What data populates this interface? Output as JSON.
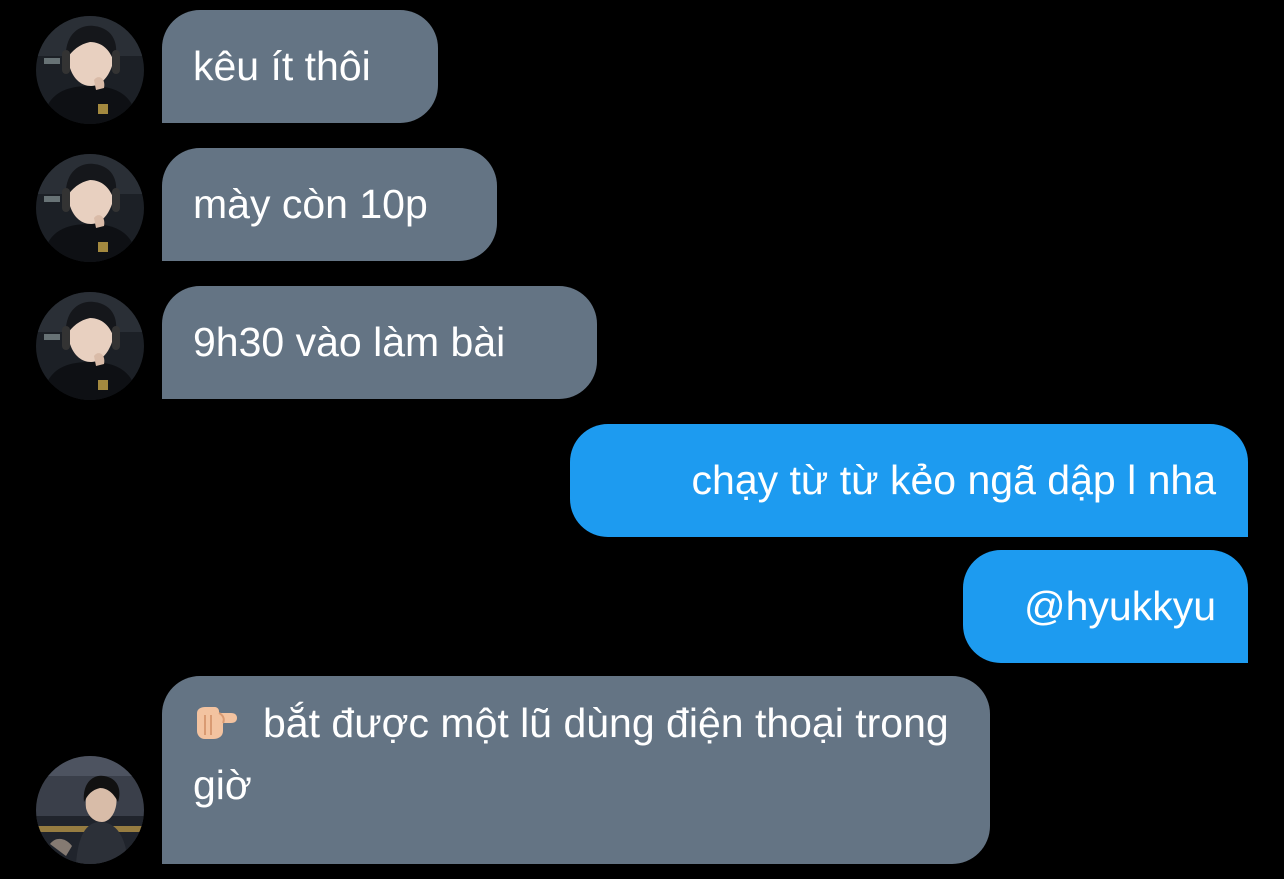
{
  "conversation": {
    "messages": [
      {
        "direction": "incoming",
        "text": "kêu ít thôi"
      },
      {
        "direction": "incoming",
        "text": "mày còn 10p"
      },
      {
        "direction": "incoming",
        "text": "9h30 vào làm bài"
      },
      {
        "direction": "outgoing",
        "text": "chạy từ từ kẻo ngã dập l nha"
      },
      {
        "direction": "outgoing",
        "text": "@hyukkyu"
      },
      {
        "direction": "incoming",
        "emoji": "pointing-finger-emoji",
        "text": "bắt được một lũ dùng điện thoại trong giờ"
      }
    ]
  },
  "theme": {
    "background": "#000000",
    "incoming_bubble": "#647484",
    "outgoing_bubble": "#1d9bf0",
    "text": "#ffffff"
  }
}
